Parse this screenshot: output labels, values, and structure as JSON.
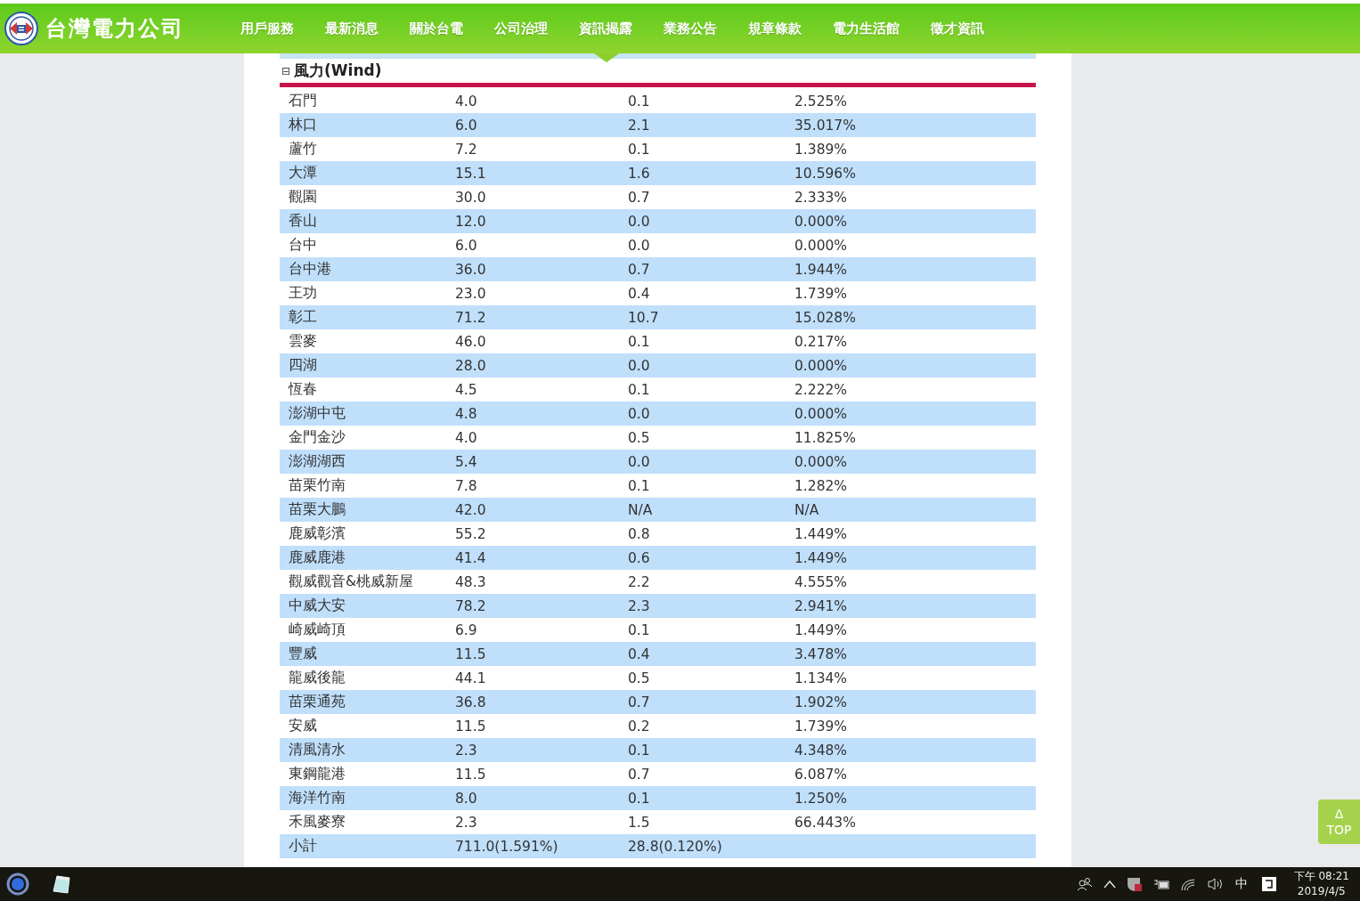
{
  "header": {
    "logo_text": "台灣電力公司",
    "nav": [
      {
        "label": "用戶服務",
        "selected": false
      },
      {
        "label": "最新消息",
        "selected": false
      },
      {
        "label": "關於台電",
        "selected": false
      },
      {
        "label": "公司治理",
        "selected": false
      },
      {
        "label": "資訊揭露",
        "selected": true
      },
      {
        "label": "業務公告",
        "selected": false
      },
      {
        "label": "規章條款",
        "selected": false
      },
      {
        "label": "電力生活館",
        "selected": false
      },
      {
        "label": "徵才資訊",
        "selected": false
      }
    ]
  },
  "section": {
    "toggle": "⊟",
    "title": "風力(Wind)",
    "rows": [
      [
        "石門",
        "4.0",
        "0.1",
        "2.525%"
      ],
      [
        "林口",
        "6.0",
        "2.1",
        "35.017%"
      ],
      [
        "蘆竹",
        "7.2",
        "0.1",
        "1.389%"
      ],
      [
        "大潭",
        "15.1",
        "1.6",
        "10.596%"
      ],
      [
        "觀園",
        "30.0",
        "0.7",
        "2.333%"
      ],
      [
        "香山",
        "12.0",
        "0.0",
        "0.000%"
      ],
      [
        "台中",
        "6.0",
        "0.0",
        "0.000%"
      ],
      [
        "台中港",
        "36.0",
        "0.7",
        "1.944%"
      ],
      [
        "王功",
        "23.0",
        "0.4",
        "1.739%"
      ],
      [
        "彰工",
        "71.2",
        "10.7",
        "15.028%"
      ],
      [
        "雲麥",
        "46.0",
        "0.1",
        "0.217%"
      ],
      [
        "四湖",
        "28.0",
        "0.0",
        "0.000%"
      ],
      [
        "恆春",
        "4.5",
        "0.1",
        "2.222%"
      ],
      [
        "澎湖中屯",
        "4.8",
        "0.0",
        "0.000%"
      ],
      [
        "金門金沙",
        "4.0",
        "0.5",
        "11.825%"
      ],
      [
        "澎湖湖西",
        "5.4",
        "0.0",
        "0.000%"
      ],
      [
        "苗栗竹南",
        "7.8",
        "0.1",
        "1.282%"
      ],
      [
        "苗栗大鵬",
        "42.0",
        "N/A",
        "N/A"
      ],
      [
        "鹿威彰濱",
        "55.2",
        "0.8",
        "1.449%"
      ],
      [
        "鹿威鹿港",
        "41.4",
        "0.6",
        "1.449%"
      ],
      [
        "觀威觀音&桃威新屋",
        "48.3",
        "2.2",
        "4.555%"
      ],
      [
        "中威大安",
        "78.2",
        "2.3",
        "2.941%"
      ],
      [
        "崎威崎頂",
        "6.9",
        "0.1",
        "1.449%"
      ],
      [
        "豐威",
        "11.5",
        "0.4",
        "3.478%"
      ],
      [
        "龍威後龍",
        "44.1",
        "0.5",
        "1.134%"
      ],
      [
        "苗栗通苑",
        "36.8",
        "0.7",
        "1.902%"
      ],
      [
        "安威",
        "11.5",
        "0.2",
        "1.739%"
      ],
      [
        "清風清水",
        "2.3",
        "0.1",
        "4.348%"
      ],
      [
        "東鋼龍港",
        "11.5",
        "0.7",
        "6.087%"
      ],
      [
        "海洋竹南",
        "8.0",
        "0.1",
        "1.250%"
      ],
      [
        "禾風麥寮",
        "2.3",
        "1.5",
        "66.443%"
      ],
      [
        "小計",
        "711.0(1.591%)",
        "28.8(0.120%)",
        ""
      ]
    ]
  },
  "top_button": {
    "arrow": "Δ",
    "label": "TOP"
  },
  "taskbar": {
    "ime": "中",
    "time": "下午 08:21",
    "date": "2019/4/5"
  }
}
